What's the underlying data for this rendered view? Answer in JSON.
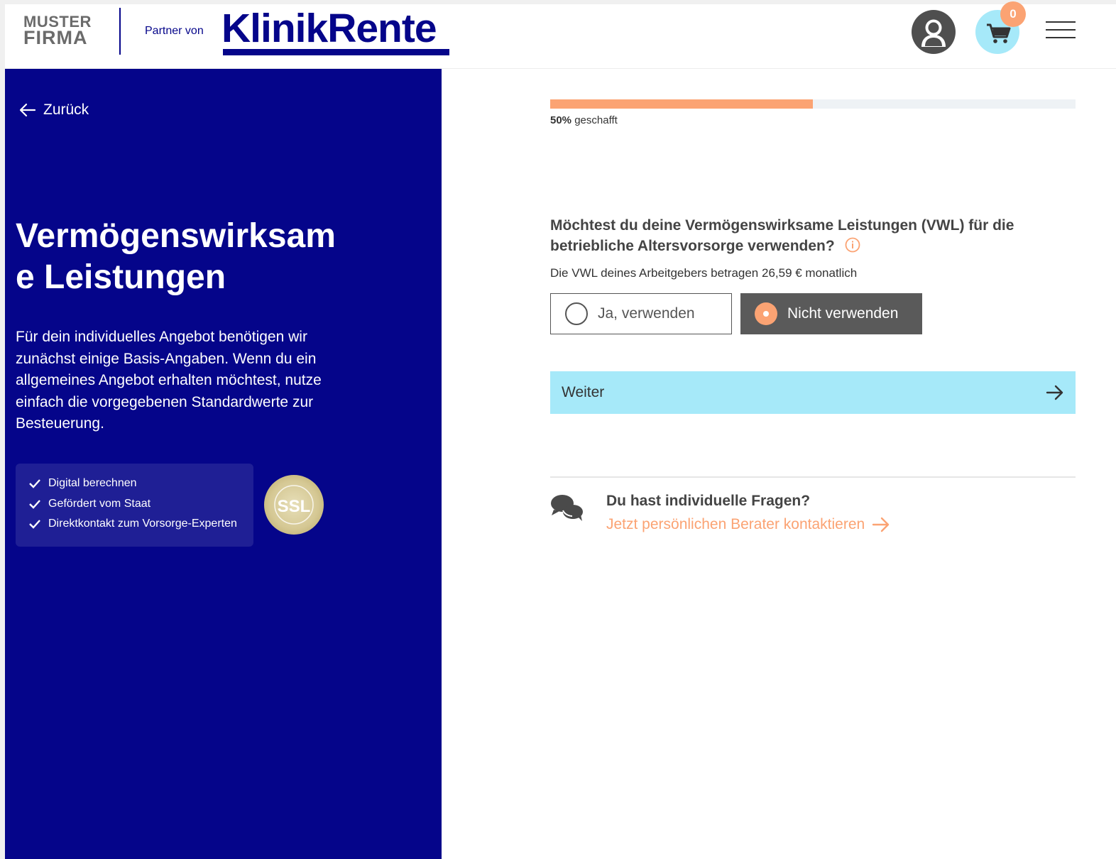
{
  "header": {
    "logo_line1": "MUSTER",
    "logo_line2": "FIRMA",
    "partner_text": "Partner von",
    "brand": "KlinikRente",
    "cart_count": "0",
    "icons": [
      "user-icon",
      "cart-icon",
      "menu-icon"
    ]
  },
  "left": {
    "back_label": "Zurück",
    "title": "Vermögenswirksame Leistungen",
    "intro": "Für dein individuelles Angebot benötigen wir zunächst einige Basis-Angaben. Wenn du ein allgemeines Angebot erhalten möchtest, nutze einfach die vorgegebenen Standardwerte zur Besteuerung.",
    "features": [
      "Digital berechnen",
      "Gefördert vom Staat",
      "Direktkontakt zum Vorsorge-Experten"
    ],
    "ssl_label": "SSL",
    "ssl_ring_text": "DATENSICHERHEIT"
  },
  "progress": {
    "fraction": 0.5,
    "percent_label": "50%",
    "label": "geschafft"
  },
  "question": {
    "text": "Möchtest du deine Vermögenswirksame Leistungen (VWL) für die betriebliche Altersvorsorge verwenden?",
    "subtext": "Die VWL deines Arbeitgebers betragen 26,59 € monatlich",
    "options": [
      {
        "label": "Ja, verwenden",
        "selected": false
      },
      {
        "label": "Nicht verwenden",
        "selected": true
      }
    ]
  },
  "next_label": "Weiter",
  "help": {
    "title": "Du hast individuelle Fragen?",
    "link": "Jetzt persönlichen Berater kontaktieren"
  },
  "colors": {
    "navy": "#05058a",
    "accent": "#fba373",
    "cyan": "#a6e9f9",
    "selected_bg": "#5a5a5a"
  }
}
